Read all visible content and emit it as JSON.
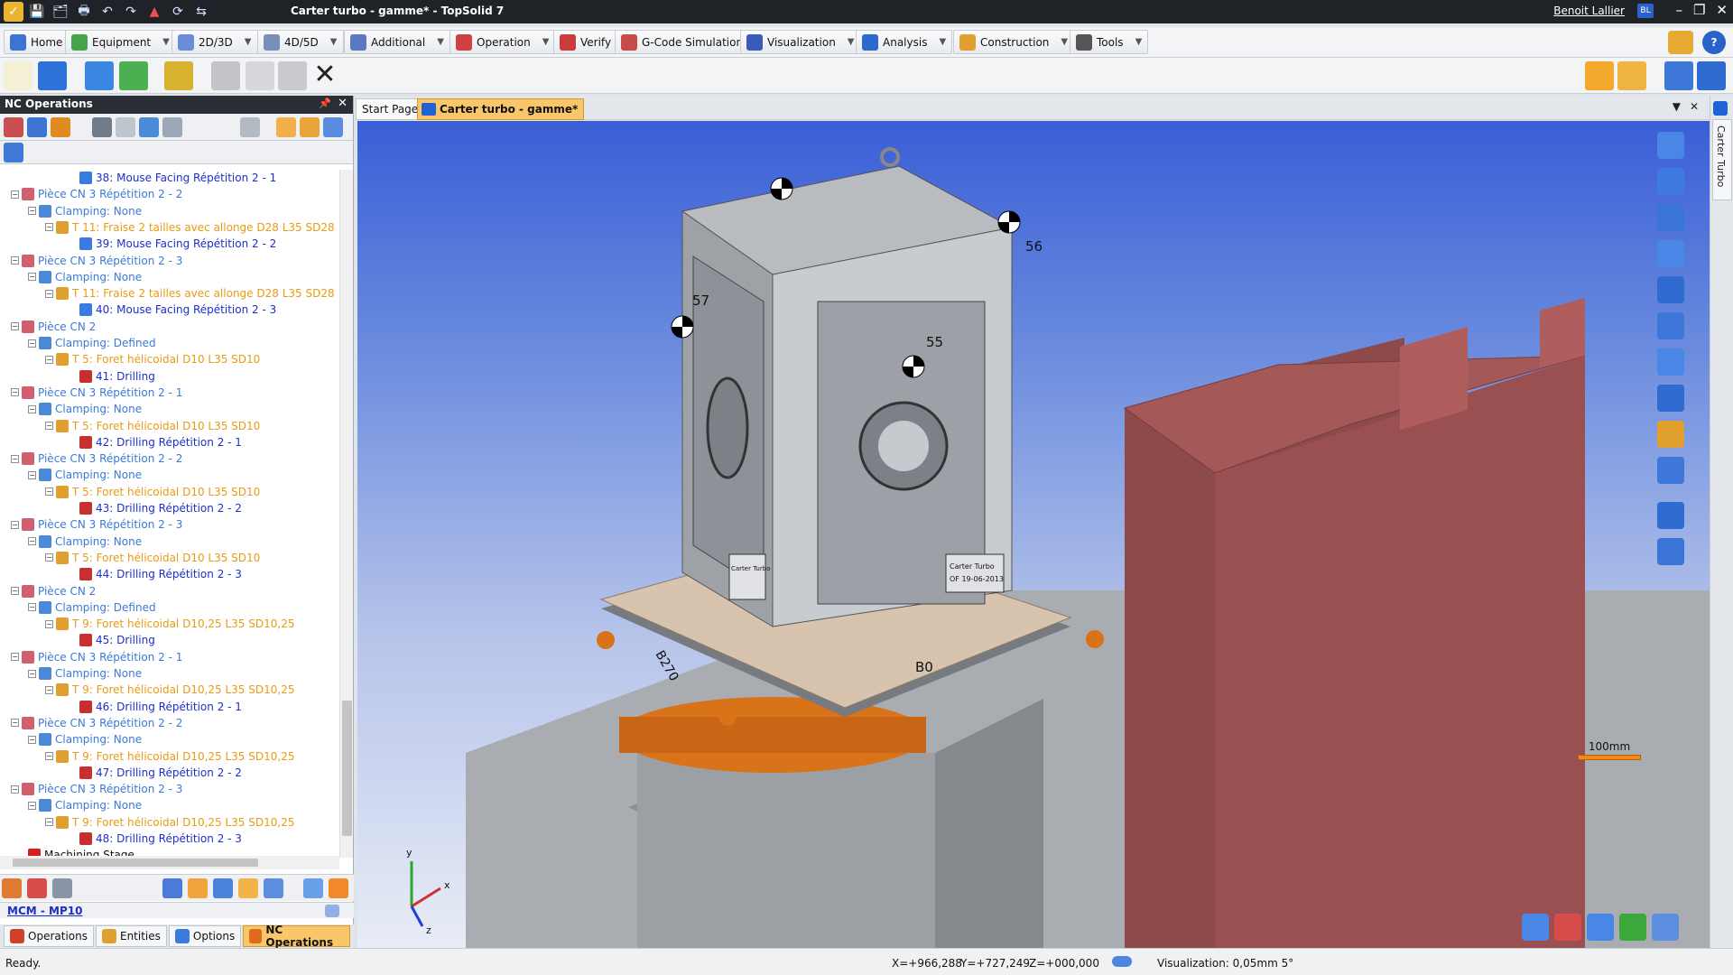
{
  "titlebar": {
    "title": "Carter turbo - gamme* - TopSolid 7",
    "user": "Benoit Lallier",
    "user_badge": "BL",
    "controls": [
      "–",
      "❐",
      "✕"
    ]
  },
  "menu": {
    "tabs": [
      {
        "label": "Home",
        "color": "#3a74d6"
      },
      {
        "label": "Equipment",
        "color": "#46a34a"
      },
      {
        "label": "2D/3D",
        "color": "#6b8cd8"
      },
      {
        "label": "4D/5D",
        "color": "#7a8fb8"
      },
      {
        "label": "Additional",
        "color": "#5b78c0"
      },
      {
        "label": "Operation",
        "color": "#d04040"
      },
      {
        "label": "Verify",
        "color": "#c83c3c"
      },
      {
        "label": "G-Code Simulation",
        "color": "#c84a4a"
      },
      {
        "label": "Visualization",
        "color": "#3b5bb8"
      },
      {
        "label": "Analysis",
        "color": "#2d6ad0"
      },
      {
        "label": "Construction",
        "color": "#e0a030"
      },
      {
        "label": "Tools",
        "color": "#555"
      }
    ]
  },
  "left_panel": {
    "title": "NC Operations",
    "pin": "📌",
    "close": "✕",
    "tree": [
      {
        "indent": 4,
        "toggle": "",
        "icon": "#3a7be0",
        "text": "38: Mouse Facing Répétition 2 - 1",
        "cls": "blue"
      },
      {
        "indent": 0,
        "toggle": "−",
        "icon": "#d06070",
        "text": "Pièce CN 3 Répétition 2 - 2",
        "cls": "lblue"
      },
      {
        "indent": 1,
        "toggle": "−",
        "icon": "#4a8ad8",
        "text": "Clamping: None",
        "cls": "lblue"
      },
      {
        "indent": 2,
        "toggle": "−",
        "icon": "#e0a030",
        "text": "T 11: Fraise 2 tailles avec allonge D28 L35 SD28",
        "cls": "orange"
      },
      {
        "indent": 4,
        "toggle": "",
        "icon": "#3a7be0",
        "text": "39: Mouse Facing Répétition 2 - 2",
        "cls": "blue"
      },
      {
        "indent": 0,
        "toggle": "−",
        "icon": "#d06070",
        "text": "Pièce CN 3 Répétition 2 - 3",
        "cls": "lblue"
      },
      {
        "indent": 1,
        "toggle": "−",
        "icon": "#4a8ad8",
        "text": "Clamping: None",
        "cls": "lblue"
      },
      {
        "indent": 2,
        "toggle": "−",
        "icon": "#e0a030",
        "text": "T 11: Fraise 2 tailles avec allonge D28 L35 SD28",
        "cls": "orange"
      },
      {
        "indent": 4,
        "toggle": "",
        "icon": "#3a7be0",
        "text": "40: Mouse Facing Répétition 2 - 3",
        "cls": "blue"
      },
      {
        "indent": 0,
        "toggle": "−",
        "icon": "#d06070",
        "text": "Pièce CN 2",
        "cls": "lblue"
      },
      {
        "indent": 1,
        "toggle": "−",
        "icon": "#4a8ad8",
        "text": "Clamping: Defined",
        "cls": "lblue"
      },
      {
        "indent": 2,
        "toggle": "−",
        "icon": "#e0a030",
        "text": "T 5: Foret hélicoidal D10 L35 SD10",
        "cls": "orange"
      },
      {
        "indent": 4,
        "toggle": "",
        "icon": "#c83030",
        "text": "41: Drilling",
        "cls": "blue"
      },
      {
        "indent": 0,
        "toggle": "−",
        "icon": "#d06070",
        "text": "Pièce CN 3 Répétition 2 - 1",
        "cls": "lblue"
      },
      {
        "indent": 1,
        "toggle": "−",
        "icon": "#4a8ad8",
        "text": "Clamping: None",
        "cls": "lblue"
      },
      {
        "indent": 2,
        "toggle": "−",
        "icon": "#e0a030",
        "text": "T 5: Foret hélicoidal D10 L35 SD10",
        "cls": "orange"
      },
      {
        "indent": 4,
        "toggle": "",
        "icon": "#c83030",
        "text": "42: Drilling Répétition 2 - 1",
        "cls": "blue"
      },
      {
        "indent": 0,
        "toggle": "−",
        "icon": "#d06070",
        "text": "Pièce CN 3 Répétition 2 - 2",
        "cls": "lblue"
      },
      {
        "indent": 1,
        "toggle": "−",
        "icon": "#4a8ad8",
        "text": "Clamping: None",
        "cls": "lblue"
      },
      {
        "indent": 2,
        "toggle": "−",
        "icon": "#e0a030",
        "text": "T 5: Foret hélicoidal D10 L35 SD10",
        "cls": "orange"
      },
      {
        "indent": 4,
        "toggle": "",
        "icon": "#c83030",
        "text": "43: Drilling Répétition 2 - 2",
        "cls": "blue"
      },
      {
        "indent": 0,
        "toggle": "−",
        "icon": "#d06070",
        "text": "Pièce CN 3 Répétition 2 - 3",
        "cls": "lblue"
      },
      {
        "indent": 1,
        "toggle": "−",
        "icon": "#4a8ad8",
        "text": "Clamping: None",
        "cls": "lblue"
      },
      {
        "indent": 2,
        "toggle": "−",
        "icon": "#e0a030",
        "text": "T 5: Foret hélicoidal D10 L35 SD10",
        "cls": "orange"
      },
      {
        "indent": 4,
        "toggle": "",
        "icon": "#c83030",
        "text": "44: Drilling Répétition 2 - 3",
        "cls": "blue"
      },
      {
        "indent": 0,
        "toggle": "−",
        "icon": "#d06070",
        "text": "Pièce CN 2",
        "cls": "lblue"
      },
      {
        "indent": 1,
        "toggle": "−",
        "icon": "#4a8ad8",
        "text": "Clamping: Defined",
        "cls": "lblue"
      },
      {
        "indent": 2,
        "toggle": "−",
        "icon": "#e0a030",
        "text": "T 9: Foret hélicoidal D10,25 L35 SD10,25",
        "cls": "orange"
      },
      {
        "indent": 4,
        "toggle": "",
        "icon": "#c83030",
        "text": "45: Drilling",
        "cls": "blue"
      },
      {
        "indent": 0,
        "toggle": "−",
        "icon": "#d06070",
        "text": "Pièce CN 3 Répétition 2 - 1",
        "cls": "lblue"
      },
      {
        "indent": 1,
        "toggle": "−",
        "icon": "#4a8ad8",
        "text": "Clamping: None",
        "cls": "lblue"
      },
      {
        "indent": 2,
        "toggle": "−",
        "icon": "#e0a030",
        "text": "T 9: Foret hélicoidal D10,25 L35 SD10,25",
        "cls": "orange"
      },
      {
        "indent": 4,
        "toggle": "",
        "icon": "#c83030",
        "text": "46: Drilling Répétition 2 - 1",
        "cls": "blue"
      },
      {
        "indent": 0,
        "toggle": "−",
        "icon": "#d06070",
        "text": "Pièce CN 3 Répétition 2 - 2",
        "cls": "lblue"
      },
      {
        "indent": 1,
        "toggle": "−",
        "icon": "#4a8ad8",
        "text": "Clamping: None",
        "cls": "lblue"
      },
      {
        "indent": 2,
        "toggle": "−",
        "icon": "#e0a030",
        "text": "T 9: Foret hélicoidal D10,25 L35 SD10,25",
        "cls": "orange"
      },
      {
        "indent": 4,
        "toggle": "",
        "icon": "#c83030",
        "text": "47: Drilling Répétition 2 - 2",
        "cls": "blue"
      },
      {
        "indent": 0,
        "toggle": "−",
        "icon": "#d06070",
        "text": "Pièce CN 3 Répétition 2 - 3",
        "cls": "lblue"
      },
      {
        "indent": 1,
        "toggle": "−",
        "icon": "#4a8ad8",
        "text": "Clamping: None",
        "cls": "lblue"
      },
      {
        "indent": 2,
        "toggle": "−",
        "icon": "#e0a030",
        "text": "T 9: Foret hélicoidal D10,25 L35 SD10,25",
        "cls": "orange"
      },
      {
        "indent": 4,
        "toggle": "",
        "icon": "#c83030",
        "text": "48: Drilling Répétition 2 - 3",
        "cls": "blue"
      },
      {
        "indent": 1,
        "toggle": "",
        "icon": "#d02020",
        "text": "Machining Stage",
        "cls": "dark"
      }
    ],
    "machine": "MCM - MP10",
    "tabs": [
      {
        "label": "Operations",
        "color": "#d0402a",
        "active": false
      },
      {
        "label": "Entities",
        "color": "#e0a030",
        "active": false
      },
      {
        "label": "Options",
        "color": "#3a7be0",
        "active": false
      },
      {
        "label": "NC Operations",
        "color": "#e06a1a",
        "active": true
      }
    ]
  },
  "doc_tabs": {
    "start": "Start Page",
    "active": "Carter turbo - gamme*",
    "controls": [
      "▼",
      "✕"
    ]
  },
  "right_strip": {
    "label": "Carter Turbo"
  },
  "viewport": {
    "part_labels": [
      "57",
      "56",
      "55"
    ],
    "pallet_labels": [
      "B270",
      "B0"
    ],
    "plate_text": [
      "Carter Turbo",
      "OF 19-06-2013",
      "Carter Turbo"
    ],
    "axis_labels": {
      "x": "x",
      "y": "y",
      "z": "z"
    },
    "scale_label": "100mm"
  },
  "status": {
    "ready": "Ready.",
    "x": "X=+966,288",
    "y": "Y=+727,249",
    "z": "Z=+000,000",
    "visualization": "Visualization: 0,05mm 5°"
  }
}
